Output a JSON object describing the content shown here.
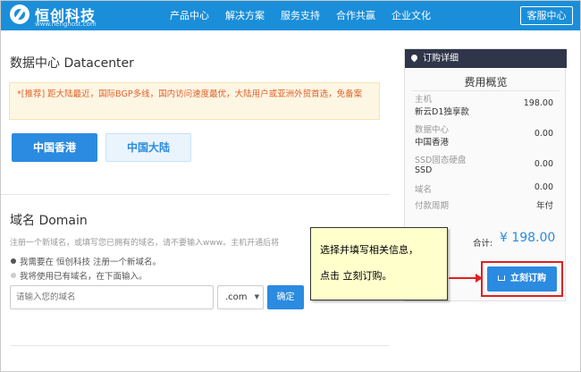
{
  "header": {
    "brand": "恒创科技",
    "brand_url": "www.henghost.com",
    "nav": [
      "产品中心",
      "解决方案",
      "服务支持",
      "合作共赢",
      "企业文化"
    ],
    "cta": "客服中心",
    "accent": "#1a8ed9"
  },
  "datacenter": {
    "title": "数据中心 Datacenter",
    "notice": "*[推荐] 距大陆最近，国际BGP多线，国内访问速度最优，大陆用户或亚洲外贸首选，免备案",
    "options": [
      "中国香港",
      "中国大陆"
    ],
    "selected": "中国香港"
  },
  "domain": {
    "title": "域名 Domain",
    "hint": "注册一个新域名，或填写您已拥有的域名，请不要输入www。主机开通后将",
    "option_new": "我需要在 恒创科技 注册一个新域名。",
    "option_existing": "我将使用已有域名，在下面输入。",
    "input_placeholder": "请输入您的域名",
    "tld": ".com",
    "confirm": "确定"
  },
  "order": {
    "header": "订购详细",
    "title": "费用概览",
    "rows": [
      {
        "label": "主机",
        "value": "新云D1独享款",
        "price": "198.00"
      },
      {
        "label": "数据中心",
        "value": "中国香港",
        "price": "0.00"
      },
      {
        "label": "SSD固态硬盘",
        "value": "SSD",
        "price": "0.00"
      },
      {
        "label": "域名",
        "value": "",
        "price": "0.00"
      },
      {
        "label": "付款周期",
        "value": "",
        "price": "年付"
      }
    ],
    "total_label": "合计:",
    "total_value": "¥ 198.00",
    "buy_button": "立刻订购",
    "total_color": "#2a8be0"
  },
  "callout": {
    "line1": "选择并填写相关信息，",
    "line2": "点击 立刻订购。",
    "highlight_color": "#e02020"
  }
}
